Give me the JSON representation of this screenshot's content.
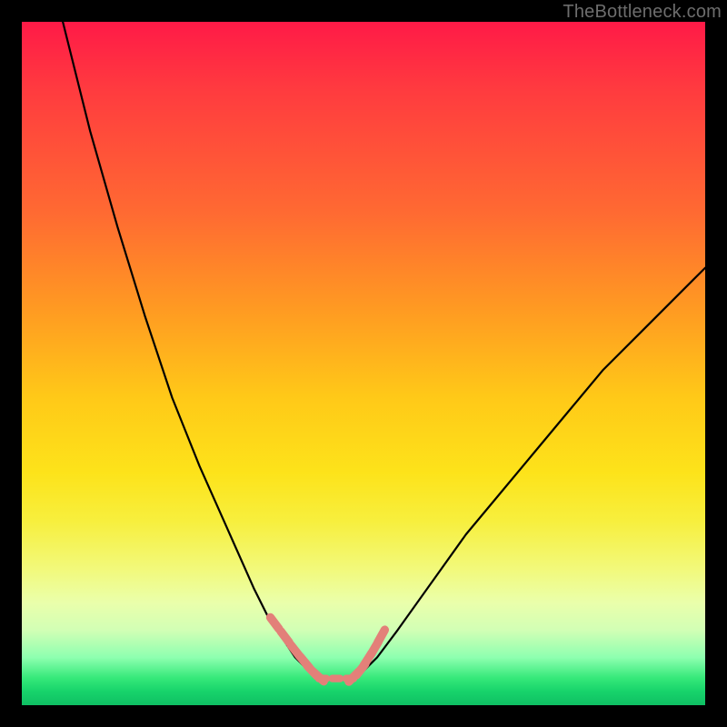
{
  "watermark": {
    "text": "TheBottleneck.com"
  },
  "chart_data": {
    "type": "line",
    "title": "",
    "xlabel": "",
    "ylabel": "",
    "xlim": [
      0,
      100
    ],
    "ylim": [
      0,
      100
    ],
    "grid": false,
    "legend": false,
    "series": [
      {
        "name": "left-lobe-curve",
        "color": "#000000",
        "x": [
          6,
          10,
          14,
          18,
          22,
          26,
          30,
          34,
          36,
          38,
          40,
          42,
          43
        ],
        "values": [
          100,
          84,
          70,
          57,
          45,
          35,
          26,
          17,
          13,
          10,
          7,
          5,
          4
        ]
      },
      {
        "name": "right-lobe-curve",
        "color": "#000000",
        "x": [
          49,
          50,
          52,
          55,
          60,
          65,
          70,
          75,
          80,
          85,
          90,
          95,
          100
        ],
        "values": [
          4,
          5,
          7,
          11,
          18,
          25,
          31,
          37,
          43,
          49,
          54,
          59,
          64
        ]
      },
      {
        "name": "valley-floor",
        "color": "#000000",
        "x": [
          43,
          49
        ],
        "values": [
          4,
          4
        ]
      },
      {
        "name": "left-lobe-markers",
        "color": "#e38079",
        "marker": "rounded-dash",
        "x": [
          37,
          38.5,
          40,
          41.4,
          42.5,
          43.4
        ],
        "values": [
          12,
          10,
          8,
          6.3,
          5,
          4.2
        ]
      },
      {
        "name": "right-lobe-markers",
        "color": "#e38079",
        "marker": "rounded-dash",
        "x": [
          48.6,
          49.6,
          50.6,
          51.6,
          52.6
        ],
        "values": [
          4.2,
          5.2,
          6.7,
          8.3,
          10.1
        ]
      },
      {
        "name": "floor-markers",
        "color": "#e38079",
        "marker": "pill",
        "x": [
          44,
          46,
          48
        ],
        "values": [
          3.9,
          3.9,
          3.9
        ]
      }
    ],
    "background_gradient": {
      "direction": "vertical",
      "stops": [
        {
          "pos": 0.0,
          "color": "#ff1a47"
        },
        {
          "pos": 0.28,
          "color": "#ff6a32"
        },
        {
          "pos": 0.55,
          "color": "#ffc918"
        },
        {
          "pos": 0.8,
          "color": "#f2f97a"
        },
        {
          "pos": 0.93,
          "color": "#8effb0"
        },
        {
          "pos": 1.0,
          "color": "#0fbf63"
        }
      ]
    }
  }
}
